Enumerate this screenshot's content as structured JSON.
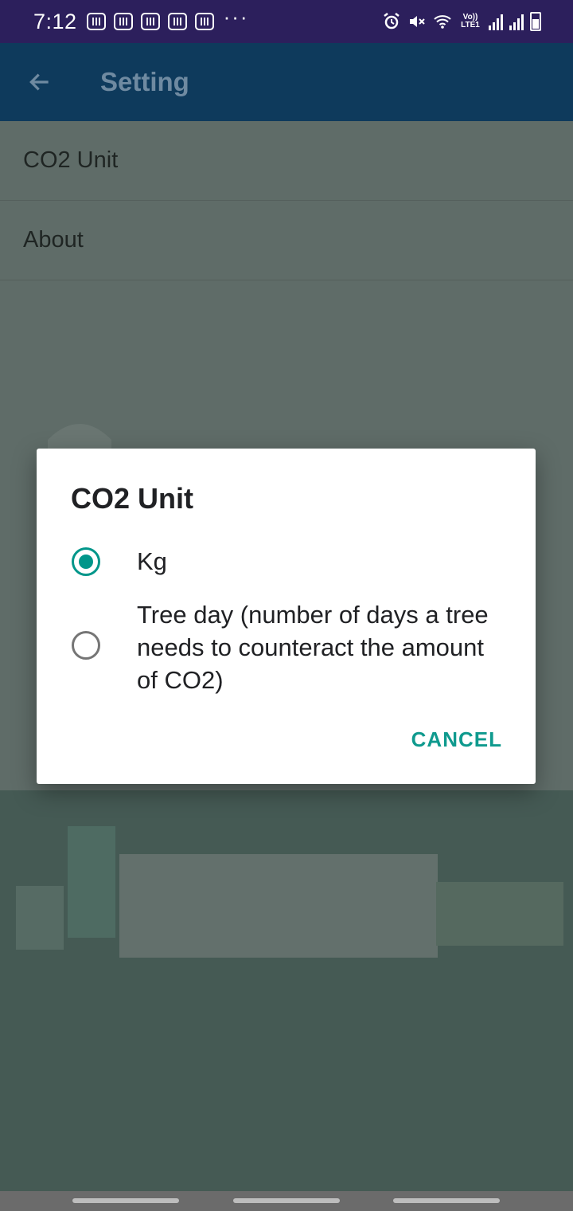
{
  "status_bar": {
    "time": "7:12",
    "more": "···",
    "lte": "Vo)) LTE1",
    "notifications": [
      "app-notification-icon",
      "app-notification-icon",
      "app-notification-icon",
      "app-notification-icon",
      "app-notification-icon"
    ],
    "battery_level": "7"
  },
  "app_bar": {
    "title": "Setting"
  },
  "settings": {
    "items": [
      {
        "label": "CO2 Unit"
      },
      {
        "label": "About"
      }
    ]
  },
  "dialog": {
    "title": "CO2 Unit",
    "options": [
      {
        "label": "Kg",
        "selected": true
      },
      {
        "label": "Tree day (number of days a tree needs to counteract the amount of CO2)",
        "selected": false
      }
    ],
    "cancel_label": "CANCEL"
  },
  "colors": {
    "status_bar": "#2c1f5c",
    "app_bar": "#0e3a5c",
    "accent": "#00968a",
    "scrim_bg": "#5f6c68"
  }
}
